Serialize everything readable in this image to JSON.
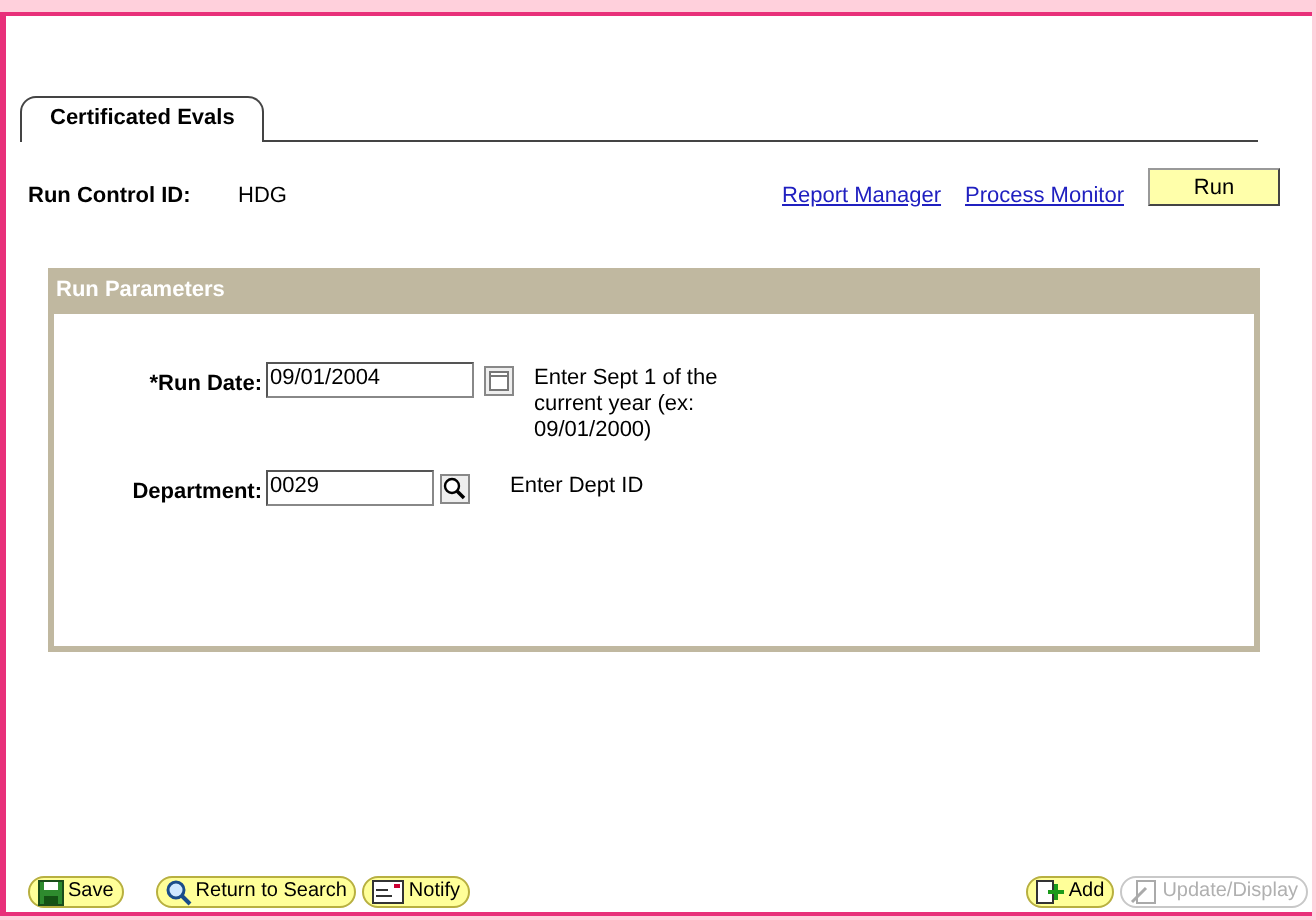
{
  "tab": {
    "label": "Certificated Evals",
    "selected": true
  },
  "run_control": {
    "label": "Run Control ID:",
    "value": "HDG"
  },
  "links": [
    "Report Manager",
    "Process Monitor"
  ],
  "run_button": "Run",
  "panel": {
    "title": "Run Parameters",
    "fields": [
      {
        "label": "*Run Date:",
        "value": "09/01/2004",
        "kind": "date",
        "hint": "Enter Sept 1 of the current year (ex: 09/01/2000)"
      },
      {
        "label": "Department:",
        "value": "0029",
        "kind": "lookup",
        "hint": "Enter Dept ID"
      }
    ]
  },
  "toolbar_left": [
    {
      "label": "Save",
      "kind": "save",
      "disabled": false
    },
    {
      "label": "Return to Search",
      "kind": "search",
      "disabled": false
    },
    {
      "label": "Notify",
      "kind": "notify",
      "disabled": false
    }
  ],
  "toolbar_right": [
    {
      "label": "Add",
      "kind": "add",
      "disabled": false
    },
    {
      "label": "Update/Display",
      "kind": "update",
      "disabled": true
    }
  ]
}
